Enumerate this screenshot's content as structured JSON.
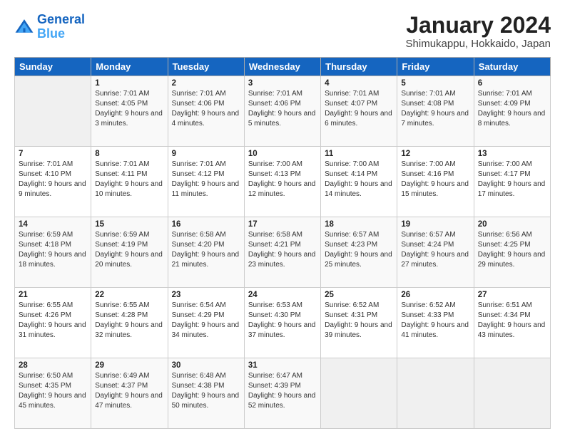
{
  "header": {
    "logo_line1": "General",
    "logo_line2": "Blue",
    "title": "January 2024",
    "subtitle": "Shimukappu, Hokkaido, Japan"
  },
  "days_of_week": [
    "Sunday",
    "Monday",
    "Tuesday",
    "Wednesday",
    "Thursday",
    "Friday",
    "Saturday"
  ],
  "weeks": [
    [
      {
        "day": "",
        "sunrise": "",
        "sunset": "",
        "daylight": ""
      },
      {
        "day": "1",
        "sunrise": "7:01 AM",
        "sunset": "4:05 PM",
        "daylight": "9 hours and 3 minutes."
      },
      {
        "day": "2",
        "sunrise": "7:01 AM",
        "sunset": "4:06 PM",
        "daylight": "9 hours and 4 minutes."
      },
      {
        "day": "3",
        "sunrise": "7:01 AM",
        "sunset": "4:06 PM",
        "daylight": "9 hours and 5 minutes."
      },
      {
        "day": "4",
        "sunrise": "7:01 AM",
        "sunset": "4:07 PM",
        "daylight": "9 hours and 6 minutes."
      },
      {
        "day": "5",
        "sunrise": "7:01 AM",
        "sunset": "4:08 PM",
        "daylight": "9 hours and 7 minutes."
      },
      {
        "day": "6",
        "sunrise": "7:01 AM",
        "sunset": "4:09 PM",
        "daylight": "9 hours and 8 minutes."
      }
    ],
    [
      {
        "day": "7",
        "sunrise": "7:01 AM",
        "sunset": "4:10 PM",
        "daylight": "9 hours and 9 minutes."
      },
      {
        "day": "8",
        "sunrise": "7:01 AM",
        "sunset": "4:11 PM",
        "daylight": "9 hours and 10 minutes."
      },
      {
        "day": "9",
        "sunrise": "7:01 AM",
        "sunset": "4:12 PM",
        "daylight": "9 hours and 11 minutes."
      },
      {
        "day": "10",
        "sunrise": "7:00 AM",
        "sunset": "4:13 PM",
        "daylight": "9 hours and 12 minutes."
      },
      {
        "day": "11",
        "sunrise": "7:00 AM",
        "sunset": "4:14 PM",
        "daylight": "9 hours and 14 minutes."
      },
      {
        "day": "12",
        "sunrise": "7:00 AM",
        "sunset": "4:16 PM",
        "daylight": "9 hours and 15 minutes."
      },
      {
        "day": "13",
        "sunrise": "7:00 AM",
        "sunset": "4:17 PM",
        "daylight": "9 hours and 17 minutes."
      }
    ],
    [
      {
        "day": "14",
        "sunrise": "6:59 AM",
        "sunset": "4:18 PM",
        "daylight": "9 hours and 18 minutes."
      },
      {
        "day": "15",
        "sunrise": "6:59 AM",
        "sunset": "4:19 PM",
        "daylight": "9 hours and 20 minutes."
      },
      {
        "day": "16",
        "sunrise": "6:58 AM",
        "sunset": "4:20 PM",
        "daylight": "9 hours and 21 minutes."
      },
      {
        "day": "17",
        "sunrise": "6:58 AM",
        "sunset": "4:21 PM",
        "daylight": "9 hours and 23 minutes."
      },
      {
        "day": "18",
        "sunrise": "6:57 AM",
        "sunset": "4:23 PM",
        "daylight": "9 hours and 25 minutes."
      },
      {
        "day": "19",
        "sunrise": "6:57 AM",
        "sunset": "4:24 PM",
        "daylight": "9 hours and 27 minutes."
      },
      {
        "day": "20",
        "sunrise": "6:56 AM",
        "sunset": "4:25 PM",
        "daylight": "9 hours and 29 minutes."
      }
    ],
    [
      {
        "day": "21",
        "sunrise": "6:55 AM",
        "sunset": "4:26 PM",
        "daylight": "9 hours and 31 minutes."
      },
      {
        "day": "22",
        "sunrise": "6:55 AM",
        "sunset": "4:28 PM",
        "daylight": "9 hours and 32 minutes."
      },
      {
        "day": "23",
        "sunrise": "6:54 AM",
        "sunset": "4:29 PM",
        "daylight": "9 hours and 34 minutes."
      },
      {
        "day": "24",
        "sunrise": "6:53 AM",
        "sunset": "4:30 PM",
        "daylight": "9 hours and 37 minutes."
      },
      {
        "day": "25",
        "sunrise": "6:52 AM",
        "sunset": "4:31 PM",
        "daylight": "9 hours and 39 minutes."
      },
      {
        "day": "26",
        "sunrise": "6:52 AM",
        "sunset": "4:33 PM",
        "daylight": "9 hours and 41 minutes."
      },
      {
        "day": "27",
        "sunrise": "6:51 AM",
        "sunset": "4:34 PM",
        "daylight": "9 hours and 43 minutes."
      }
    ],
    [
      {
        "day": "28",
        "sunrise": "6:50 AM",
        "sunset": "4:35 PM",
        "daylight": "9 hours and 45 minutes."
      },
      {
        "day": "29",
        "sunrise": "6:49 AM",
        "sunset": "4:37 PM",
        "daylight": "9 hours and 47 minutes."
      },
      {
        "day": "30",
        "sunrise": "6:48 AM",
        "sunset": "4:38 PM",
        "daylight": "9 hours and 50 minutes."
      },
      {
        "day": "31",
        "sunrise": "6:47 AM",
        "sunset": "4:39 PM",
        "daylight": "9 hours and 52 minutes."
      },
      {
        "day": "",
        "sunrise": "",
        "sunset": "",
        "daylight": ""
      },
      {
        "day": "",
        "sunrise": "",
        "sunset": "",
        "daylight": ""
      },
      {
        "day": "",
        "sunrise": "",
        "sunset": "",
        "daylight": ""
      }
    ]
  ],
  "labels": {
    "sunrise_prefix": "Sunrise: ",
    "sunset_prefix": "Sunset: ",
    "daylight_prefix": "Daylight: "
  }
}
